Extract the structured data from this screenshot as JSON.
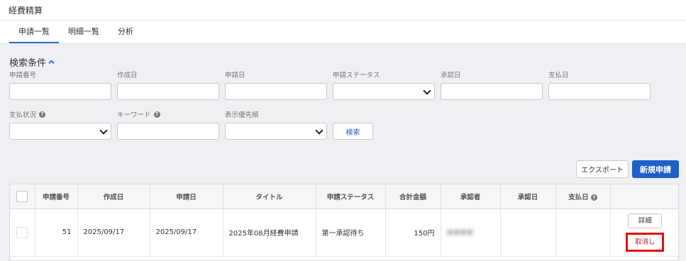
{
  "app": {
    "title": "経費精算"
  },
  "tabs": [
    {
      "label": "申請一覧",
      "active": true
    },
    {
      "label": "明細一覧",
      "active": false
    },
    {
      "label": "分析",
      "active": false
    }
  ],
  "search": {
    "title": "検索条件",
    "fields_row1": [
      {
        "label": "申請番号",
        "value": "",
        "type": "text"
      },
      {
        "label": "作成日",
        "value": "",
        "type": "text"
      },
      {
        "label": "申請日",
        "value": "",
        "type": "text"
      },
      {
        "label": "申請ステータス",
        "value": "",
        "type": "select"
      },
      {
        "label": "承認日",
        "value": "",
        "type": "text"
      },
      {
        "label": "支払日",
        "value": "",
        "type": "text"
      }
    ],
    "fields_row2": [
      {
        "label": "支払状況",
        "value": "",
        "type": "select",
        "help": true
      },
      {
        "label": "キーワード",
        "value": "",
        "type": "text",
        "help": true
      },
      {
        "label": "表示優先順",
        "value": "",
        "type": "select"
      }
    ],
    "search_button": "検索"
  },
  "actions": {
    "export": "エクスポート",
    "new": "新規申請"
  },
  "table": {
    "columns": [
      "申請番号",
      "作成日",
      "申請日",
      "タイトル",
      "申請ステータス",
      "合計金額",
      "承認者",
      "承認日",
      "支払日"
    ],
    "rows": [
      {
        "id": "51",
        "created": "2025/09/17",
        "applied": "2025/09/17",
        "title": "2025年08月経費申請",
        "status": "第一承認待ち",
        "amount": "150円",
        "approver": "■■■■",
        "approved_date": "",
        "paid_date": "",
        "detail_label": "詳細",
        "cancel_label": "取消し"
      }
    ]
  },
  "colors": {
    "accent": "#1f5fc8",
    "highlight": "#e01010"
  }
}
